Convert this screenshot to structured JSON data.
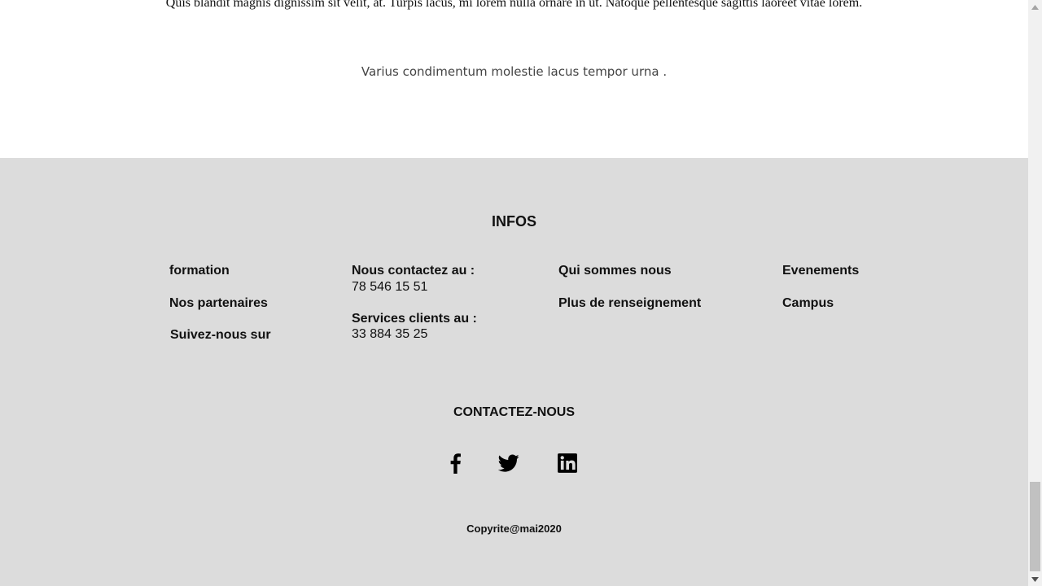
{
  "content": {
    "lorem_line": "Quis blandit magnis dignissim sit velit, at. Turpis lacus, mi lorem nulla ornare in ut. Natoque pellentesque sagittis laoreet vitae lorem.",
    "tagline": "Varius condimentum molestie lacus tempor urna ."
  },
  "footer": {
    "title": "INFOS",
    "col1": {
      "formation": "formation",
      "partenaires": "Nos partenaires",
      "suivez": "Suivez-nous sur"
    },
    "col2": {
      "contact_label": "Nous contactez au :",
      "contact_number": "78 546 15 51",
      "services_label": "Services clients au :",
      "services_number": "33 884 35 25"
    },
    "col3": {
      "qui": "Qui sommes nous",
      "plus": "Plus de renseignement"
    },
    "col4": {
      "evenements": "Evenements",
      "campus": "Campus"
    },
    "contact_title": "CONTACTEZ-NOUS",
    "social": [
      "facebook-icon",
      "twitter-icon",
      "linkedin-icon"
    ],
    "copyright": "Copyrite@mai2020"
  },
  "colors": {
    "footer_bg": "#dcdcdc",
    "text": "#111111",
    "scrollbar_track": "#f1f1f1",
    "scrollbar_thumb": "#c1c1c1"
  }
}
